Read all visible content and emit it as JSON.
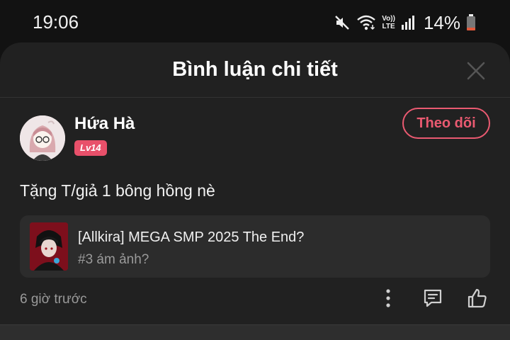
{
  "status_bar": {
    "time": "19:06",
    "network_top": "Vo))",
    "network_bottom": "LTE",
    "battery_percent": "14%",
    "icons": [
      "mute-icon",
      "wifi-icon",
      "volte-icon",
      "signal-icon",
      "battery-icon"
    ]
  },
  "sheet": {
    "title": "Bình luận chi tiết"
  },
  "comment": {
    "user_name": "Hứa Hà",
    "level": "Lv14",
    "follow_label": "Theo dõi",
    "text": "Tặng T/giả 1 bông hồng nè",
    "story": {
      "title": "[Allkira] MEGA SMP 2025 The End?",
      "chapter": "#3 ám ảnh?"
    },
    "time_ago": "6 giờ trước"
  },
  "colors": {
    "accent": "#ea5a71",
    "badge": "#e8506a",
    "sheet_bg": "#212121",
    "card_bg": "#2c2c2c",
    "muted_text": "#9a9a9a"
  }
}
